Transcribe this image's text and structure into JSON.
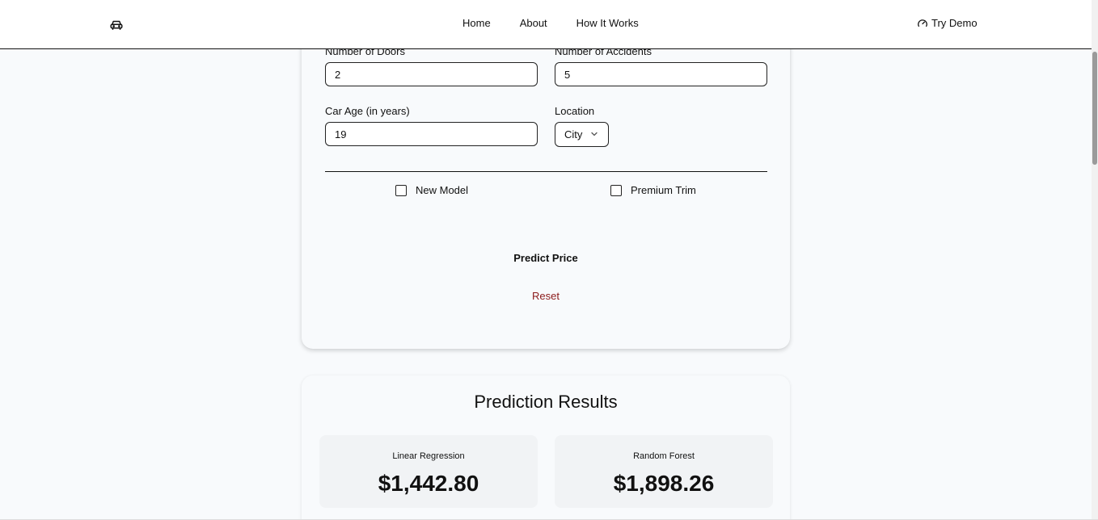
{
  "navbar": {
    "logo_icon": "car-icon",
    "links": [
      "Home",
      "About",
      "How It Works"
    ],
    "demo_icon": "gauge-icon",
    "demo_label": "Try Demo"
  },
  "form": {
    "doors_label": "Number of Doors",
    "doors_value": "2",
    "accidents_label": "Number of Accidents",
    "accidents_value": "5",
    "age_label": "Car Age (in years)",
    "age_value": "19",
    "location_label": "Location",
    "location_value": "City",
    "new_model_label": "New Model",
    "new_model_checked": false,
    "premium_label": "Premium Trim",
    "premium_checked": false,
    "predict_label": "Predict Price",
    "reset_label": "Reset"
  },
  "results": {
    "title": "Prediction Results",
    "models": [
      {
        "name": "Linear Regression",
        "price": "$1,442.80"
      },
      {
        "name": "Random Forest",
        "price": "$1,898.26"
      }
    ]
  },
  "colors": {
    "reset": "#8b1a1a",
    "background": "#f8fafc"
  }
}
